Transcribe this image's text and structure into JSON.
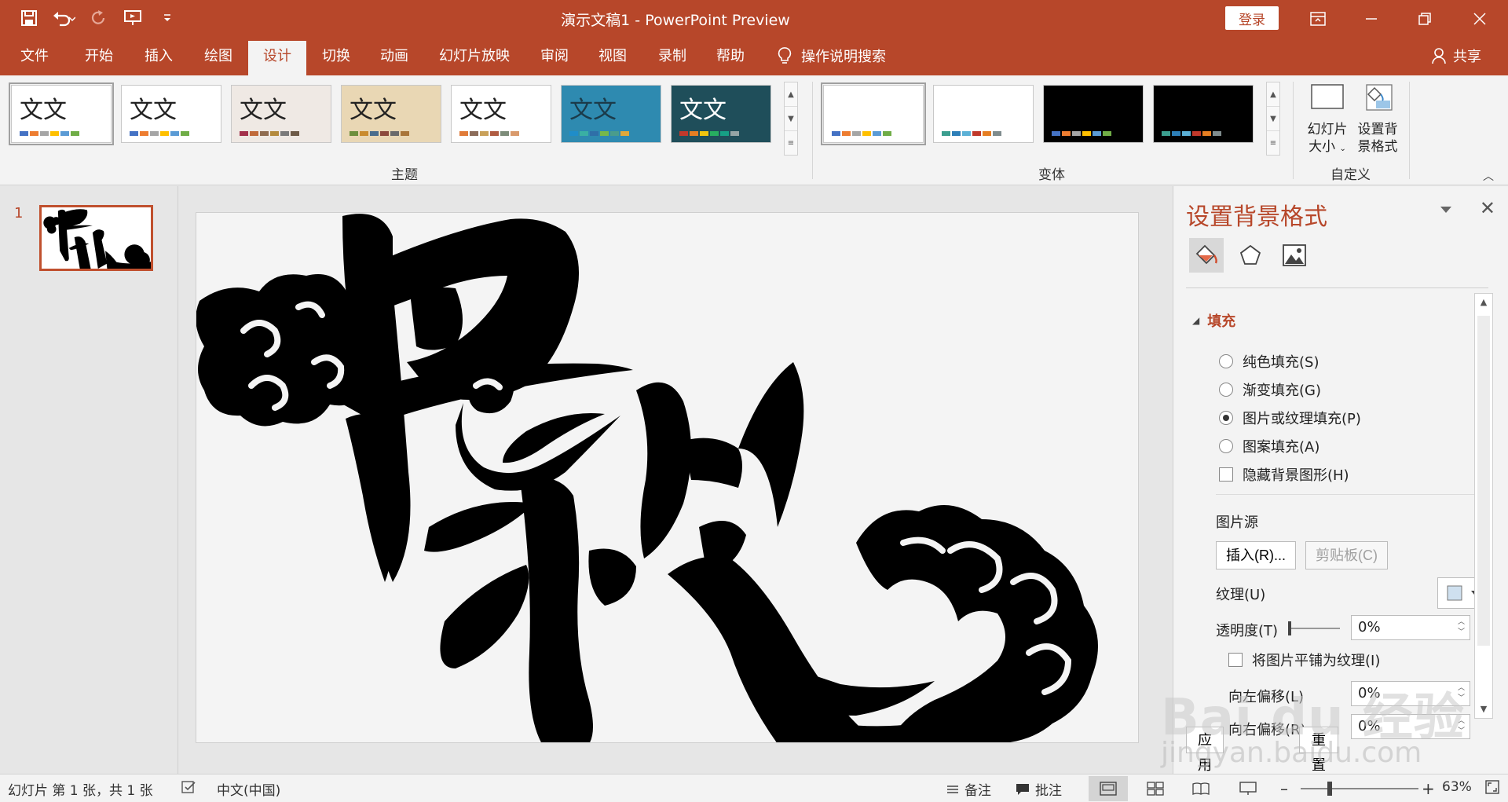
{
  "window": {
    "title": "演示文稿1  -  PowerPoint Preview",
    "login": "登录"
  },
  "tabs": [
    "文件",
    "开始",
    "插入",
    "绘图",
    "设计",
    "切换",
    "动画",
    "幻灯片放映",
    "审阅",
    "视图",
    "录制",
    "帮助"
  ],
  "active_tab": "设计",
  "tell_me": "操作说明搜索",
  "share": "共享",
  "ribbon": {
    "themes_label": "主题",
    "variants_label": "变体",
    "customize_label": "自定义",
    "theme_sample_text": "文文",
    "themes": [
      {
        "bg": "#ffffff",
        "fg": "#222222",
        "swatches": [
          "#4472c4",
          "#ed7d31",
          "#a5a5a5",
          "#ffc000",
          "#5b9bd5",
          "#70ad47"
        ]
      },
      {
        "bg": "#ffffff",
        "fg": "#222222",
        "swatches": [
          "#4472c4",
          "#ed7d31",
          "#a5a5a5",
          "#ffc000",
          "#5b9bd5",
          "#70ad47"
        ]
      },
      {
        "bg": "#efe9e4",
        "fg": "#222222",
        "swatches": [
          "#a3314b",
          "#c06a3a",
          "#8f6c50",
          "#b48a3d",
          "#7a7a7a",
          "#6e5b48"
        ]
      },
      {
        "bg": "#e9d7b4",
        "fg": "#222222",
        "swatches": [
          "#6d8f3c",
          "#c98b2e",
          "#4a6d8c",
          "#8c4a3c",
          "#6a6a6a",
          "#a8753a"
        ]
      },
      {
        "bg": "#ffffff",
        "fg": "#222222",
        "swatches": [
          "#e07b39",
          "#8c6d5a",
          "#c9a15a",
          "#b05c42",
          "#7d8c7a",
          "#d99a6c"
        ]
      },
      {
        "bg": "#2e8ab0",
        "fg": "#1b3b4a",
        "swatches": [
          "#1f8dc9",
          "#3ab0a3",
          "#2f6fa8",
          "#76b84a",
          "#4a9c8c",
          "#e0a83a"
        ]
      },
      {
        "bg": "#1f4e5a",
        "fg": "#ffffff",
        "swatches": [
          "#c0392b",
          "#e67e22",
          "#f1c40f",
          "#27ae60",
          "#16a085",
          "#95a5a6"
        ]
      }
    ],
    "variants": [
      {
        "bg": "#ffffff",
        "swatches": [
          "#4472c4",
          "#ed7d31",
          "#a5a5a5",
          "#ffc000",
          "#5b9bd5",
          "#70ad47"
        ]
      },
      {
        "bg": "#ffffff",
        "swatches": [
          "#3b9e8f",
          "#2d7fb8",
          "#5bb0d6",
          "#c0392b",
          "#e67e22",
          "#7f8c8d"
        ]
      },
      {
        "bg": "#000000",
        "swatches": [
          "#4472c4",
          "#ed7d31",
          "#a5a5a5",
          "#ffc000",
          "#5b9bd5",
          "#70ad47"
        ]
      },
      {
        "bg": "#000000",
        "swatches": [
          "#3b9e8f",
          "#2d7fb8",
          "#5bb0d6",
          "#c0392b",
          "#e67e22",
          "#7f8c8d"
        ]
      }
    ],
    "slide_size": {
      "line1": "幻灯片",
      "line2": "大小"
    },
    "format_bg": {
      "line1": "设置背",
      "line2": "景格式"
    }
  },
  "thumbnails": [
    {
      "number": "1"
    }
  ],
  "format_pane": {
    "title": "设置背景格式",
    "section": "填充",
    "fill_options": [
      {
        "label": "纯色填充(S)",
        "checked": false
      },
      {
        "label": "渐变填充(G)",
        "checked": false
      },
      {
        "label": "图片或纹理填充(P)",
        "checked": true
      },
      {
        "label": "图案填充(A)",
        "checked": false
      }
    ],
    "hide_bg": "隐藏背景图形(H)",
    "picture_source": "图片源",
    "insert_btn": "插入(R)...",
    "clipboard_btn": "剪贴板(C)",
    "texture": "纹理(U)",
    "transparency_label": "透明度(T)",
    "transparency_value": "0%",
    "tile": "将图片平铺为纹理(I)",
    "offset_left_label": "向左偏移(L)",
    "offset_left_value": "0%",
    "offset_right_label": "向右偏移(R)",
    "offset_right_value": "0%",
    "apply_all": "应用到全部(L)",
    "reset_bg": "重置背景(B)"
  },
  "status": {
    "slide_info": "幻灯片 第 1 张，共 1 张",
    "language": "中文(中国)",
    "notes": "备注",
    "comments": "批注",
    "zoom": "63%"
  },
  "watermark": {
    "text": "Bai du 经验",
    "url": "jingyan.baidu.com"
  },
  "colors": {
    "accent": "#b7472a",
    "ribbon_bg": "#f3f3f3",
    "canvas_bg": "#e6e6e6"
  }
}
